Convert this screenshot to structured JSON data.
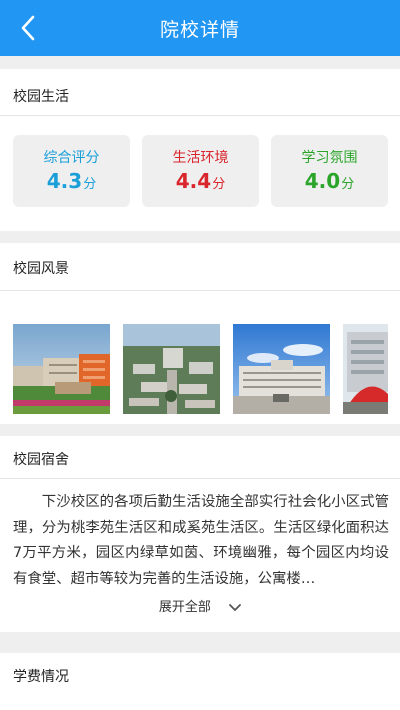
{
  "header": {
    "title": "院校详情",
    "back_icon": "chevron-left-icon"
  },
  "life": {
    "title": "校园生活",
    "scores": [
      {
        "label": "综合评分",
        "value": "4.3",
        "unit": "分",
        "color": "#1a9fd9"
      },
      {
        "label": "生活环境",
        "value": "4.4",
        "unit": "分",
        "color": "#d9252c"
      },
      {
        "label": "学习氛围",
        "value": "4.0",
        "unit": "分",
        "color": "#2aa52a"
      }
    ]
  },
  "scenery": {
    "title": "校园风景"
  },
  "dorm": {
    "title": "校园宿舍",
    "text": "下沙校区的各项后勤生活设施全部实行社会化小区式管理，分为桃李苑生活区和成奚苑生活区。生活区绿化面积达7万平方米，园区内绿草如茵、环境幽雅，每个园区内均设有食堂、超市等较为完善的生活设施，公寓楼…",
    "expand_label": "展开全部"
  },
  "tuition": {
    "title": "学费情况"
  },
  "colors": {
    "primary": "#2196f3",
    "background": "#efefef"
  }
}
